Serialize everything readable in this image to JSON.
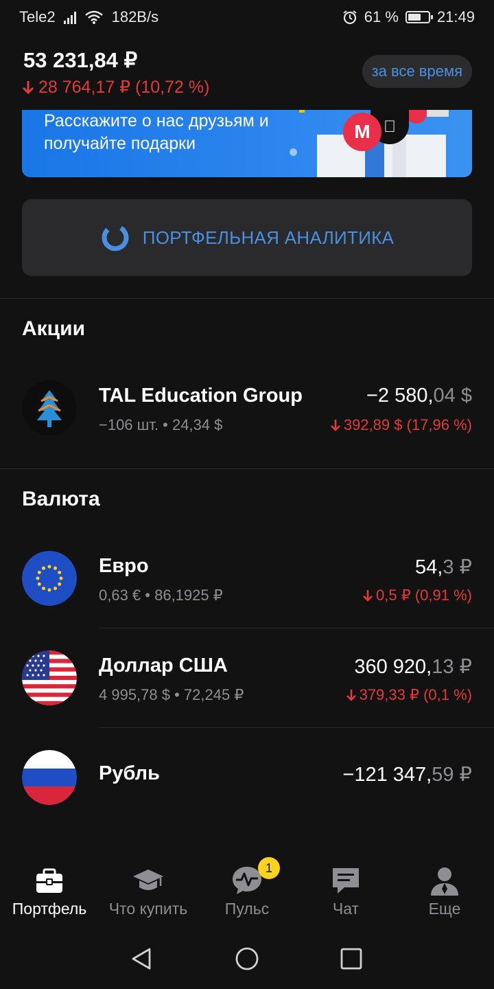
{
  "status_bar": {
    "carrier": "Tele2",
    "speed": "182B/s",
    "battery": "61 %",
    "time": "21:49"
  },
  "header": {
    "total": "53 231,84 ₽",
    "change": "28 764,17 ₽ (10,72 %)",
    "period_button": "за все время"
  },
  "banner": {
    "text": "Расскажите о нас друзьям и получайте подарки",
    "logo_letter": "M"
  },
  "analytics_button": {
    "label": "ПОРТФЕЛЬНАЯ АНАЛИТИКА"
  },
  "sections": {
    "stocks": {
      "title": "Акции",
      "items": [
        {
          "name": "TAL Education Group",
          "subtitle": "−106 шт. • 24,34 $",
          "value_main": "−2 580,",
          "value_cents": "04 $",
          "change": "392,89 $ (17,96 %)"
        }
      ]
    },
    "currency": {
      "title": "Валюта",
      "items": [
        {
          "name": "Евро",
          "subtitle": "0,63 € • 86,1925 ₽",
          "value_main": "54,",
          "value_cents": "3 ₽",
          "change": "0,5 ₽ (0,91 %)"
        },
        {
          "name": "Доллар США",
          "subtitle": "4 995,78 $ • 72,245 ₽",
          "value_main": "360 920,",
          "value_cents": "13 ₽",
          "change": "379,33 ₽ (0,1 %)"
        },
        {
          "name": "Рубль",
          "value_main": "−121 347,",
          "value_cents": "59 ₽"
        }
      ]
    }
  },
  "bottom_nav": {
    "items": [
      {
        "label": "Портфель",
        "icon": "briefcase-icon",
        "active": true
      },
      {
        "label": "Что купить",
        "icon": "graduation-cap-icon",
        "active": false
      },
      {
        "label": "Пульс",
        "icon": "pulse-chat-icon",
        "active": false,
        "badge": "1"
      },
      {
        "label": "Чат",
        "icon": "chat-icon",
        "active": false
      },
      {
        "label": "Еще",
        "icon": "person-icon",
        "active": false
      }
    ]
  },
  "colors": {
    "background": "#121212",
    "accent": "#4a90e2",
    "negative": "#e23a3a",
    "secondary_text": "#8e8e93",
    "badge": "#ffd21f"
  }
}
